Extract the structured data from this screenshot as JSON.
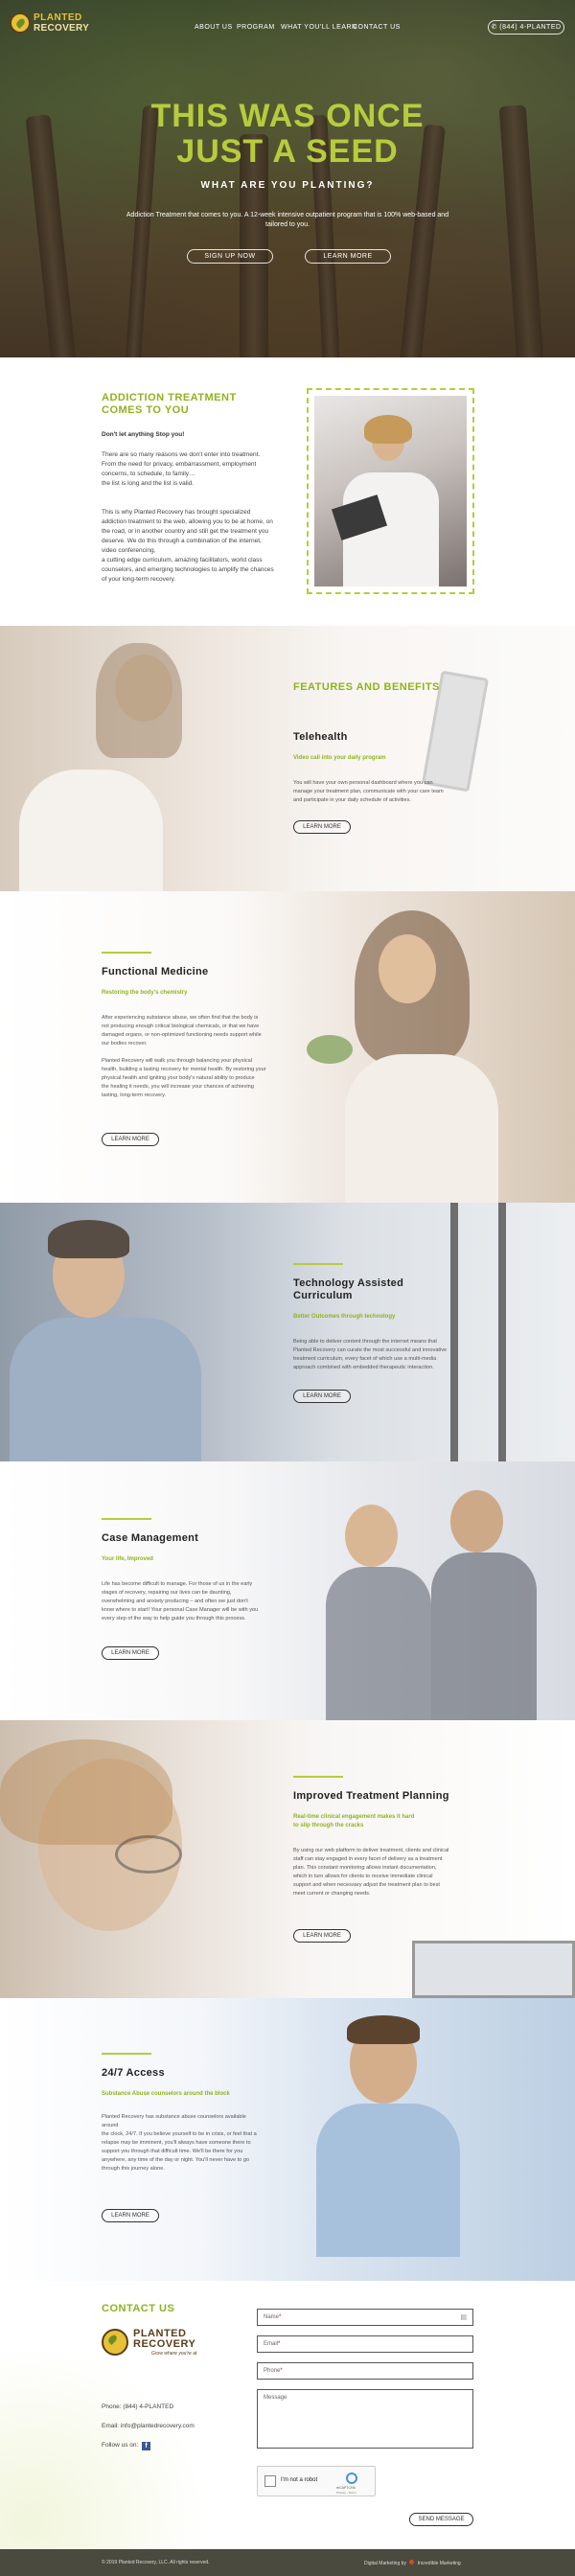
{
  "brand": {
    "line1": "PLANTED",
    "line2": "RECOVERY",
    "tagline": "Grow where you're at"
  },
  "nav": {
    "items": [
      "ABOUT US",
      "PROGRAM",
      "WHAT YOU'LL LEARN",
      "CONTACT US"
    ],
    "phone_label": "(844) 4-PLANTED"
  },
  "hero": {
    "title_line1": "THIS WAS ONCE",
    "title_line2": "JUST A SEED",
    "subtitle": "WHAT ARE YOU PLANTING?",
    "text_line1": "Addiction Treatment that comes to you. A 12-week intensive outpatient program that is 100% web-based and",
    "text_line2": "tailored to you.",
    "btn_signup": "SIGN UP NOW",
    "btn_learn": "LEARN MORE"
  },
  "addiction": {
    "title_line1": "ADDICTION TREATMENT",
    "title_line2": "COMES TO YOU",
    "lead": "Don't let anything Stop you!",
    "p1": [
      "There are so many reasons we don't enter into treatment.",
      "From the need for privacy, embarrassment, employment",
      "concerns, to schedule, to family…",
      "the list is long and the list is valid."
    ],
    "p2": [
      "This is why Planted Recovery has brought specialized",
      "addiction treatment to the web, allowing you to be at home, on",
      "the road, or in another country and still get the treatment you",
      "deserve. We do this through a combination of the internet,",
      "video conferencing,",
      "a cutting edge curriculum, amazing facilitators, world class",
      "counselors, and emerging technologies to amplify the chances",
      "of your long-term recovery."
    ]
  },
  "features": {
    "heading": "FEATURES AND BENEFITS",
    "items": [
      {
        "title": "Telehealth",
        "sub": "Video call into your daily program",
        "body": [
          "You will have your own personal dashboard where you can",
          "manage your treatment plan, communicate with your care team",
          "and participate in your daily schedule of activities."
        ],
        "btn": "LEARN MORE"
      },
      {
        "title": "Functional Medicine",
        "sub": "Restoring the body's chemistry",
        "body": [
          "After experiencing substance abuse, we often find that the body is",
          "not producing enough critical biological chemicals, or that we have",
          "damaged organs, or non-optimized functioning needs support while",
          "our bodies recover.",
          "",
          "Planted Recovery will walk you through balancing your physical",
          "health, building a lasting recovery for mental health. By restoring your",
          "physical health and igniting your body's natural ability to produce",
          "the healing it needs, you will increase your chances of achieving",
          "lasting, long-term recovery."
        ],
        "btn": "LEARN MORE"
      },
      {
        "title_line1": "Technology Assisted",
        "title_line2": "Curriculum",
        "sub": "Better Outcomes through technology",
        "body": [
          "Being able to deliver content through the internet means that",
          "Planted Recovery can curate the most successful and innovative",
          "treatment curriculum, every facet of which use a multi-media",
          "approach combined with embedded therapeutic interaction."
        ],
        "btn": "LEARN MORE"
      },
      {
        "title": "Case Management",
        "sub": "Your life, Improved",
        "body": [
          "Life has become difficult to manage. For those of us in the early",
          "stages of recovery, repairing our lives can be daunting,",
          "overwhelming and anxiety producing – and often we just don't",
          "know where to start! Your personal Case Manager will be with you",
          "every step of the way to help guide you through this process."
        ],
        "btn": "LEARN MORE"
      },
      {
        "title": "Improved Treatment Planning",
        "sub_line1": "Real-time clinical engagement makes it hard",
        "sub_line2": "to slip through the cracks",
        "body": [
          "By using our web platform to deliver treatment, clients and clinical",
          "staff can stay engaged in every facet of delivery as a treatment",
          "plan. This constant monitoring allows instant documentation,",
          "which in turn allows for clients to receive immediate clinical",
          "support and when necessary adjust the treatment plan to best",
          "meet current or changing needs."
        ],
        "btn": "LEARN MORE"
      },
      {
        "title": "24/7 Access",
        "sub": "Substance Abuse counselors around the block",
        "body": [
          "Planted Recovery has substance abuse counselors available",
          "around",
          "the clock, 24/7. If you believe yourself to be in crisis, or feel that a",
          "relapse may be imminent, you'll always have someone there to",
          "support you through that difficult time. We'll be there for you",
          "anywhere, any time of the day or night. You'll never have to go",
          "through this journey alone."
        ],
        "btn": "LEARN MORE"
      }
    ]
  },
  "contact": {
    "title": "CONTACT US",
    "phone": "Phone: (844) 4-PLANTED",
    "email": "Email: info@plantedrecovery.com",
    "follow": "Follow us on:",
    "form": {
      "name": "Name",
      "email": "Email",
      "phone": "Phone",
      "message": "Message",
      "captcha": "I'm not a robot",
      "captcha_brand": "reCAPTCHA",
      "captcha_terms": "Privacy - Terms",
      "send": "SEND MESSAGE"
    }
  },
  "footer": {
    "copyright": "© 2019 Planted Recovery, LLC. All rights reserved.",
    "credit": "Digital Marketing by",
    "credit_brand": "Incredible Marketing"
  },
  "colors": {
    "accent": "#b7cc3c",
    "brand_dark": "#5b3d1a",
    "footer_bg": "#4a4a3e"
  }
}
